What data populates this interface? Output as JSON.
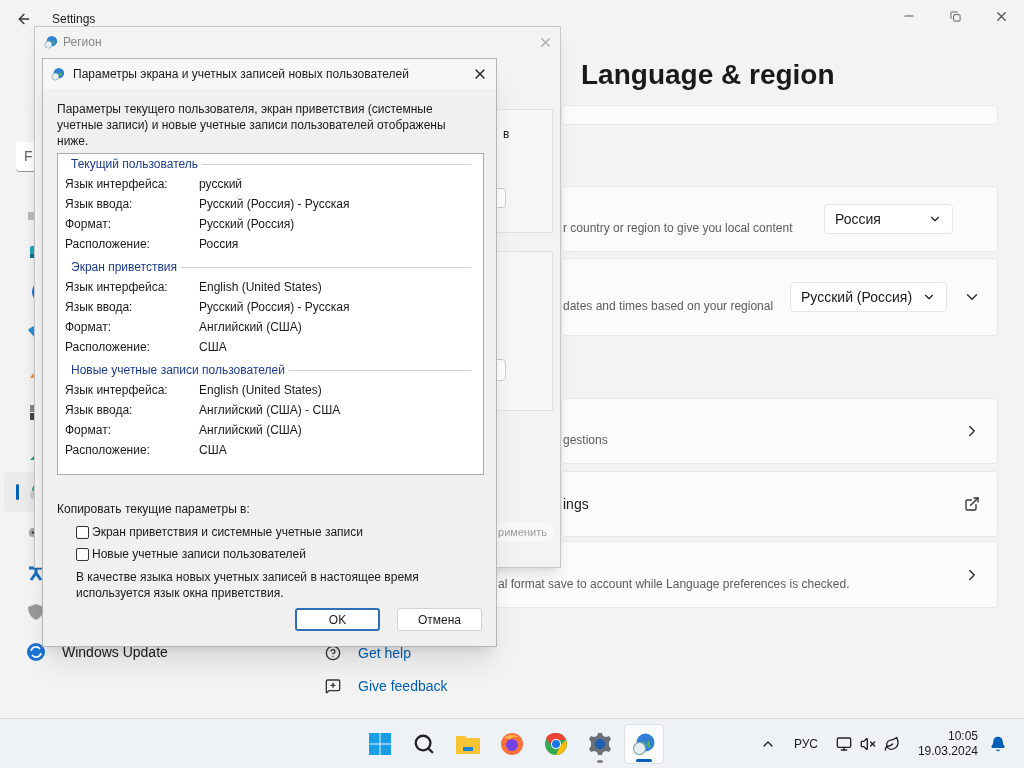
{
  "settings": {
    "title": "Settings",
    "page_title": "Language & region",
    "search": {
      "placeholder": "F"
    },
    "sidebar": {
      "items": [
        {
          "selected": false
        },
        {
          "selected": false
        },
        {
          "selected": false
        },
        {
          "selected": false
        },
        {
          "selected": false
        },
        {
          "selected": false
        },
        {
          "selected": false
        },
        {
          "selected": true
        },
        {
          "selected": false
        },
        {
          "selected": false
        },
        {
          "selected": false
        },
        {
          "label": "Windows Update",
          "selected": false
        }
      ]
    },
    "cards": [
      {
        "kind": "blank"
      },
      {
        "kind": "dropdown",
        "description": "r country or region to give you local content",
        "value": "Россия"
      },
      {
        "kind": "dropdown_expand",
        "description": "dates and times based on your regional",
        "value": "Русский (Россия)",
        "expanded": false
      },
      {
        "kind": "chevron",
        "description": "gestions"
      },
      {
        "kind": "external",
        "title": "ings"
      },
      {
        "kind": "chevron",
        "description": "al format save to account while Language preferences is checked."
      }
    ],
    "links": [
      {
        "kind": "help",
        "label": "Get help"
      },
      {
        "kind": "feedback",
        "label": "Give feedback"
      }
    ]
  },
  "region_window": {
    "title": "Регион",
    "fragment": "в",
    "apply_button": {
      "label": "рименить",
      "disabled": true
    }
  },
  "dialog": {
    "title": "Параметры экрана и учетных записей новых пользователей",
    "intro": "Параметры текущего пользователя, экран приветствия (системные учетные записи) и новые учетные записи пользователей отображены ниже.",
    "sections": [
      {
        "heading": "Текущий пользователь",
        "rows": [
          {
            "label": "Язык интерфейса:",
            "value": "русский"
          },
          {
            "label": "Язык ввода:",
            "value": "Русский (Россия) - Русская"
          },
          {
            "label": "Формат:",
            "value": "Русский (Россия)"
          },
          {
            "label": "Расположение:",
            "value": "Россия"
          }
        ]
      },
      {
        "heading": "Экран приветствия",
        "rows": [
          {
            "label": "Язык интерфейса:",
            "value": "English (United States)"
          },
          {
            "label": "Язык ввода:",
            "value": "Русский (Россия) - Русская"
          },
          {
            "label": "Формат:",
            "value": "Английский (США)"
          },
          {
            "label": "Расположение:",
            "value": "США"
          }
        ]
      },
      {
        "heading": "Новые учетные записи пользователей",
        "rows": [
          {
            "label": "Язык интерфейса:",
            "value": "English (United States)"
          },
          {
            "label": "Язык ввода:",
            "value": "Английский (США) - США"
          },
          {
            "label": "Формат:",
            "value": "Английский (США)"
          },
          {
            "label": "Расположение:",
            "value": "США"
          }
        ]
      }
    ],
    "copy_label": "Копировать текущие параметры в:",
    "options": [
      {
        "label": "Экран приветствия и системные учетные записи",
        "checked": false
      },
      {
        "label": "Новые учетные записи пользователей",
        "checked": false
      }
    ],
    "note": "В качестве языка новых учетных записей в настоящее время используется язык окна приветствия.",
    "buttons": [
      {
        "label": "OK",
        "default": true
      },
      {
        "label": "Отмена",
        "default": false
      }
    ]
  },
  "taskbar": {
    "apps": [
      {
        "kind": "start",
        "running": false,
        "selected": false
      },
      {
        "kind": "search",
        "running": false,
        "selected": false
      },
      {
        "kind": "explorer",
        "running": false,
        "selected": false
      },
      {
        "kind": "firefox",
        "running": false,
        "selected": false
      },
      {
        "kind": "chrome",
        "running": false,
        "selected": false
      },
      {
        "kind": "settings",
        "running": true,
        "selected": false
      },
      {
        "kind": "region",
        "running": true,
        "selected": true
      }
    ],
    "language": "РУС",
    "time": "10:05",
    "date": "19.03.2024"
  }
}
